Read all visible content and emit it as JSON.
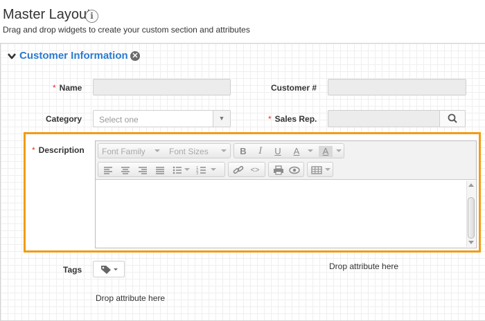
{
  "header": {
    "title": "Master Layout",
    "subtitle": "Drag and drop widgets to create your custom section and attributes",
    "info_icon_glyph": "i"
  },
  "section": {
    "title": "Customer Information",
    "collapse_icon": "chevron-down-icon",
    "remove_icon_glyph": "✕",
    "title_color": "#2a7ad0"
  },
  "fields": {
    "name": {
      "label": "Name",
      "required_mark": "*",
      "value": ""
    },
    "customer_number": {
      "label": "Customer #",
      "value": ""
    },
    "category": {
      "label": "Category",
      "placeholder": "Select one",
      "arrow_glyph": "▼"
    },
    "sales_rep": {
      "label": "Sales Rep.",
      "required_mark": "*",
      "value": "",
      "search_icon": "search-icon"
    },
    "description": {
      "label": "Description",
      "required_mark": "*"
    },
    "tags": {
      "label": "Tags",
      "icon": "tag-icon"
    }
  },
  "editor": {
    "font_family": "Font Family",
    "font_sizes": "Font Sizes",
    "bold": "B",
    "italic": "I",
    "underline": "U",
    "text_color": "A",
    "highlight_color": "A",
    "source_code": "<>"
  },
  "drop_zones": {
    "right": "Drop attribute here",
    "left": "Drop attribute here"
  },
  "colors": {
    "highlight_border": "#f39b12",
    "required": "#d9342b"
  }
}
